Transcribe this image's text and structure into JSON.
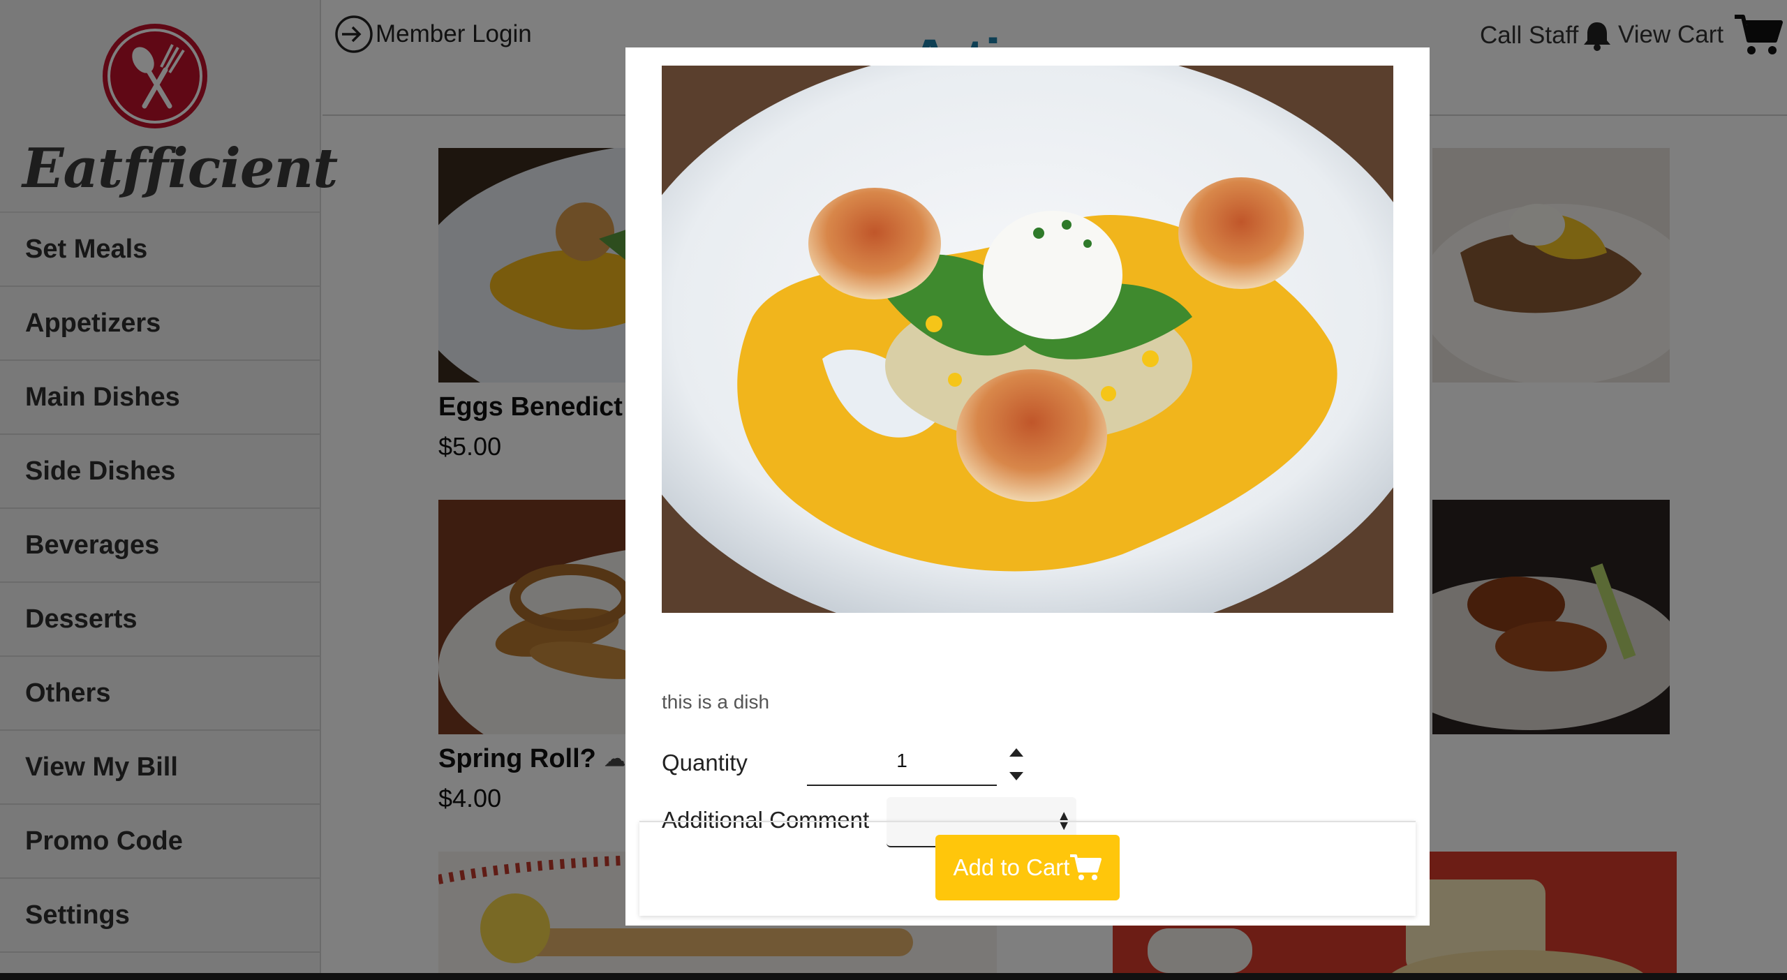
{
  "app": {
    "brand": "Eatfficient"
  },
  "sidebar": {
    "items": [
      {
        "label": "Set Meals"
      },
      {
        "label": "Appetizers"
      },
      {
        "label": "Main Dishes"
      },
      {
        "label": "Side Dishes"
      },
      {
        "label": "Beverages"
      },
      {
        "label": "Desserts"
      },
      {
        "label": "Others"
      },
      {
        "label": "View My Bill"
      },
      {
        "label": "Promo Code"
      },
      {
        "label": "Settings"
      }
    ]
  },
  "header": {
    "login_label": "Member Login",
    "page_heading_fragment": "A    ti",
    "call_staff_label": "Call Staff",
    "view_cart_label": "View Cart"
  },
  "menu": {
    "cards": [
      {
        "name": "Eggs Benedict",
        "price": "$5.00"
      },
      {
        "name": "Spring Roll?",
        "price": "$4.00"
      }
    ]
  },
  "modal": {
    "description": "this is a dish",
    "quantity_label": "Quantity",
    "quantity_value": "1",
    "comment_label": "Additional Comment",
    "comment_value": "",
    "add_to_cart_label": "Add to Cart"
  },
  "colors": {
    "brand_red": "#c0102a",
    "accent_yellow": "#ffc60b",
    "heading_blue": "#1d7fa8"
  },
  "icons": {
    "login": "arrow-in-circle-icon",
    "call_staff": "bell-icon",
    "view_cart": "cart-icon",
    "add_to_cart": "cart-icon",
    "chef": "chef-hat-icon"
  }
}
